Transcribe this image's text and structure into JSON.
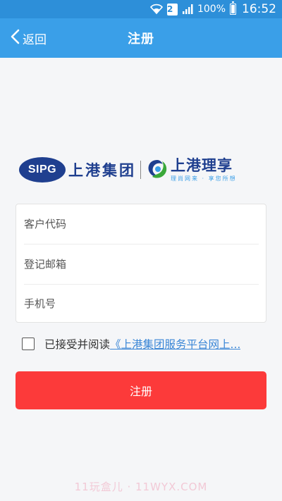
{
  "status_bar": {
    "sim": "2",
    "battery": "100%",
    "time": "16:52"
  },
  "header": {
    "back_label": "返回",
    "title": "注册"
  },
  "logo": {
    "sipg_text": "SIPG",
    "sipg_cn": "上港集团",
    "brand_main": "上港理享",
    "brand_sub": "理尚网来 · 享您所想"
  },
  "form": {
    "customer_code_placeholder": "客户代码",
    "email_placeholder": "登记邮箱",
    "phone_placeholder": "手机号"
  },
  "agreement": {
    "text": "已接受并阅读",
    "link": "《上港集团服务平台网上..."
  },
  "register_button": "注册",
  "watermark": "11玩盒儿 · 11WYX.COM",
  "colors": {
    "header_blue": "#3a9fe8",
    "status_blue": "#2d8fd9",
    "brand_navy": "#1f3f8f",
    "button_red": "#fc3a3a",
    "link_blue": "#3a86d6"
  }
}
